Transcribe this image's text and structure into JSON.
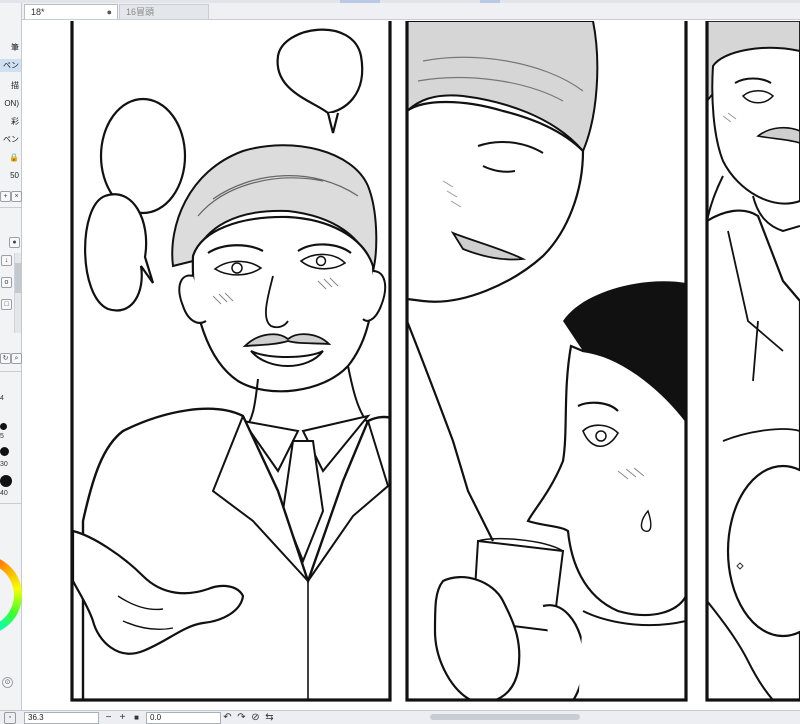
{
  "tabs": [
    {
      "label": "18*",
      "modified_marker": "●",
      "active": true
    },
    {
      "label": "16冒頭",
      "active": false
    }
  ],
  "sidebar": {
    "items": [
      "筆",
      "ペン",
      "描",
      "ON)",
      "彩",
      "ペン",
      "🔒",
      "50"
    ],
    "brush_sizes": [
      "4",
      "5",
      "30",
      "40"
    ]
  },
  "statusbar": {
    "zoom_value": "36.3",
    "angle_value": "0.0",
    "zoom_out_label": "−",
    "zoom_in_label": "+",
    "fit_label": "■"
  },
  "colors": {
    "accent": "#3d8bd9",
    "ink": "#111111",
    "screentone": "#c8c8c8"
  },
  "icons": [
    "lock-icon",
    "add-layer-icon",
    "delete-layer-icon",
    "download-icon",
    "rotate-icon",
    "search-icon",
    "close-icon"
  ]
}
